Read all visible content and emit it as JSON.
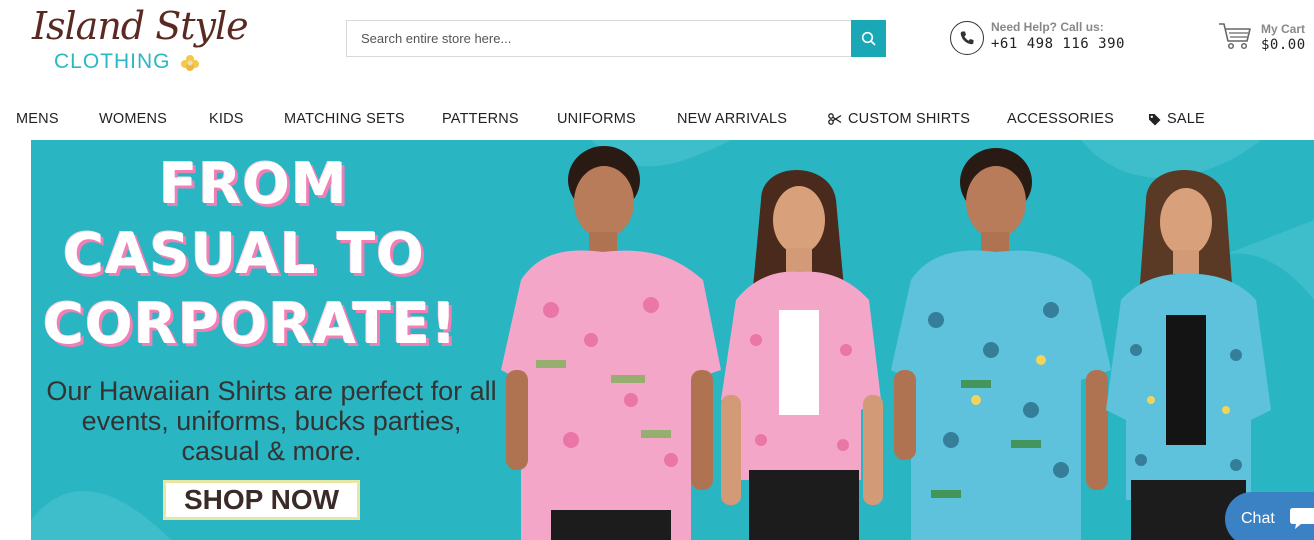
{
  "logo": {
    "script": "Island Style",
    "sub": "CLOTHING"
  },
  "search": {
    "placeholder": "Search entire store here..."
  },
  "help": {
    "label": "Need Help? Call us:",
    "phone": "+61 498 116 390"
  },
  "cart": {
    "label": "My Cart",
    "total": "$0.00"
  },
  "nav": {
    "items": [
      {
        "label": "MENS"
      },
      {
        "label": "WOMENS"
      },
      {
        "label": "KIDS"
      },
      {
        "label": "MATCHING SETS"
      },
      {
        "label": "PATTERNS"
      },
      {
        "label": "UNIFORMS"
      },
      {
        "label": "NEW ARRIVALS"
      },
      {
        "label": "CUSTOM SHIRTS",
        "icon": "scissors-icon"
      },
      {
        "label": "ACCESSORIES"
      },
      {
        "label": "SALE",
        "icon": "tag-icon"
      }
    ]
  },
  "hero": {
    "line1": "FROM",
    "line2": "CASUAL TO",
    "line3": "CORPORATE!",
    "subtitle": "Our Hawaiian Shirts are perfect for all events, uniforms, bucks parties, casual & more.",
    "cta": "SHOP NOW"
  },
  "chat": {
    "label": "Chat"
  },
  "colors": {
    "accent": "#1aa8b6",
    "hero_bg": "#2ab5c3",
    "brand_brown": "#5a2a22",
    "chat": "#3b82c4"
  }
}
